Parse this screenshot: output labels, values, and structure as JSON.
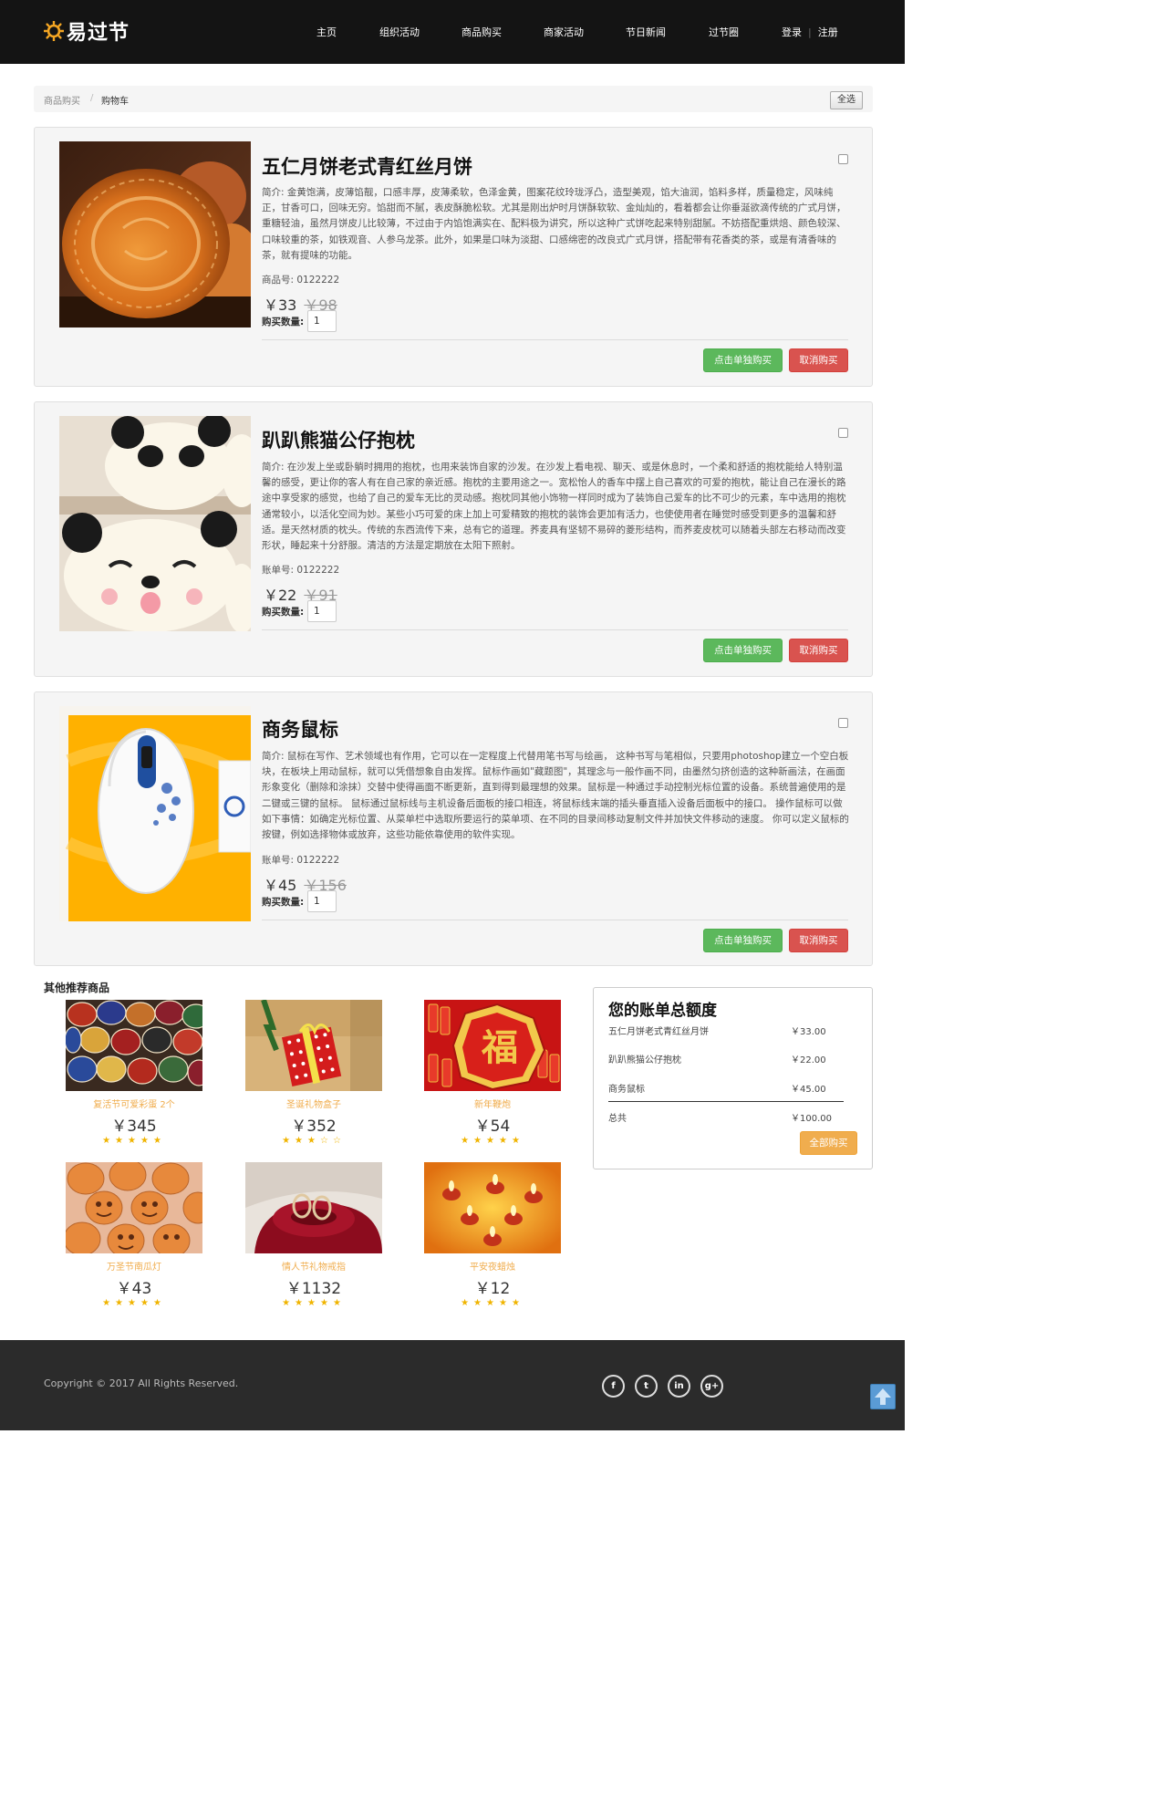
{
  "brand": {
    "name": "易过节"
  },
  "nav": [
    {
      "label": "主页"
    },
    {
      "label": "组织活动"
    },
    {
      "label": "商品购买"
    },
    {
      "label": "商家活动"
    },
    {
      "label": "节日新闻"
    },
    {
      "label": "过节圈"
    }
  ],
  "auth": {
    "login": "登录",
    "sep": "|",
    "register": "注册"
  },
  "breadcrumb": {
    "parent": "商品购买",
    "sep": "/",
    "current": "购物车",
    "select_all": "全选"
  },
  "cart": [
    {
      "title": "五仁月饼老式青红丝月饼",
      "desc": "简介: 金黄饱满，皮薄馅靓，口感丰厚，皮薄柔软，色泽金黄，图案花纹玲珑浮凸，造型美观，馅大油润，馅料多样，质量稳定，风味纯正，甘香可口，回味无穷。馅甜而不腻，表皮酥脆松软。尤其是刚出炉时月饼酥软软、金灿灿的，看着都会让你垂涎欲滴传统的广式月饼，重糖轻油，虽然月饼皮儿比较薄，不过由于内馅饱满实在、配料极为讲究，所以这种广式饼吃起来特别甜腻。不妨搭配重烘焙、颜色较深、口味较重的茶，如铁观音、人参乌龙茶。此外，如果是口味为淡甜、口感绵密的改良式广式月饼，搭配带有花香类的茶，或是有清香味的茶，就有提味的功能。",
      "no": "商品号: 0122222",
      "price": "￥33",
      "old_price": "￥98",
      "qty_label": "购买数量:",
      "qty": "1",
      "buy": "点击单独购买",
      "cancel": "取消购买"
    },
    {
      "title": "趴趴熊猫公仔抱枕",
      "desc": "简介: 在沙发上坐或卧躺时拥用的抱枕，也用来装饰自家的沙发。在沙发上看电视、聊天、或是休息时，一个柔和舒适的抱枕能给人特别温馨的感受，更让你的客人有在自己家的亲近感。抱枕的主要用途之一。宽松怡人的香车中摆上自己喜欢的可爱的抱枕，能让自己在漫长的路途中享受家的感觉，也给了自己的爱车无比的灵动感。抱枕同其他小饰物一样同时成为了装饰自己爱车的比不可少的元素，车中选用的抱枕通常较小，以活化空间为妙。某些小巧可爱的床上加上可爱精致的抱枕的装饰会更加有活力，也使使用者在睡觉时感受到更多的温馨和舒适。是天然材质的枕头。传统的东西流传下来，总有它的道理。荞麦具有坚韧不易碎的菱形结构，而荞麦皮枕可以随着头部左右移动而改变形状，睡起来十分舒服。清洁的方法是定期放在太阳下照射。",
      "no": "账单号: 0122222",
      "price": "￥22",
      "old_price": "￥91",
      "qty_label": "购买数量:",
      "qty": "1",
      "buy": "点击单独购买",
      "cancel": "取消购买"
    },
    {
      "title": "商务鼠标",
      "desc": "简介: 鼠标在写作、艺术领域也有作用，它可以在一定程度上代替用笔书写与绘画， 这种书写与笔相似，只要用photoshop建立一个空白板块，在板块上用动鼠标，就可以凭借想象自由发挥。鼠标作画如\"藏题图\"，其理念与一般作画不同，由墨然匀挤创造的这种新画法，在画面形象变化（删除和涂抹）交替中使得画面不断更新，直到得到最理想的效果。鼠标是一种通过手动控制光标位置的设备。系统普遍使用的是二键或三键的鼠标。 鼠标通过鼠标线与主机设备后面板的接口相连，将鼠标线末端的插头垂直插入设备后面板中的接口。 操作鼠标可以做如下事情：如确定光标位置、从菜单栏中选取所要运行的菜单项、在不同的目录间移动复制文件并加快文件移动的速度。 你可以定义鼠标的按键，例如选择物体或放弃，这些功能依靠使用的软件实现。",
      "no": "账单号: 0122222",
      "price": "￥45",
      "old_price": "￥156",
      "qty_label": "购买数量:",
      "qty": "1",
      "buy": "点击单独购买",
      "cancel": "取消购买"
    }
  ],
  "recommend": {
    "title": "其他推荐商品",
    "items": [
      {
        "name": "复活节可爱彩蛋 2个",
        "price": "￥345",
        "stars": "★★★★★"
      },
      {
        "name": "圣诞礼物盒子",
        "price": "￥352",
        "stars": "★★★☆☆"
      },
      {
        "name": "新年鞭炮",
        "price": "￥54",
        "stars": "★★★★★"
      },
      {
        "name": "万圣节南瓜灯",
        "price": "￥43",
        "stars": "★★★★★"
      },
      {
        "name": "情人节礼物戒指",
        "price": "￥1132",
        "stars": "★★★★★"
      },
      {
        "name": "平安夜蜡烛",
        "price": "￥12",
        "stars": "★★★★★"
      }
    ]
  },
  "bill": {
    "title": "您的账单总额度",
    "rows": [
      {
        "name": "五仁月饼老式青红丝月饼",
        "amount": "￥33.00"
      },
      {
        "name": "趴趴熊猫公仔抱枕",
        "amount": "￥22.00"
      },
      {
        "name": "商务鼠标",
        "amount": "￥45.00"
      }
    ],
    "total_label": "总共",
    "total": "￥100.00",
    "buy_all": "全部购买"
  },
  "footer": {
    "copyright": "Copyright © 2017 All Rights Reserved.",
    "social": [
      "f",
      "t",
      "in",
      "g+"
    ]
  },
  "colors": {
    "header_bg": "#141414",
    "accent_orange": "#f0ad4e",
    "buy_green": "#5cb85c",
    "cancel_red": "#d9534f",
    "footer_bg": "#2b2b2b"
  }
}
